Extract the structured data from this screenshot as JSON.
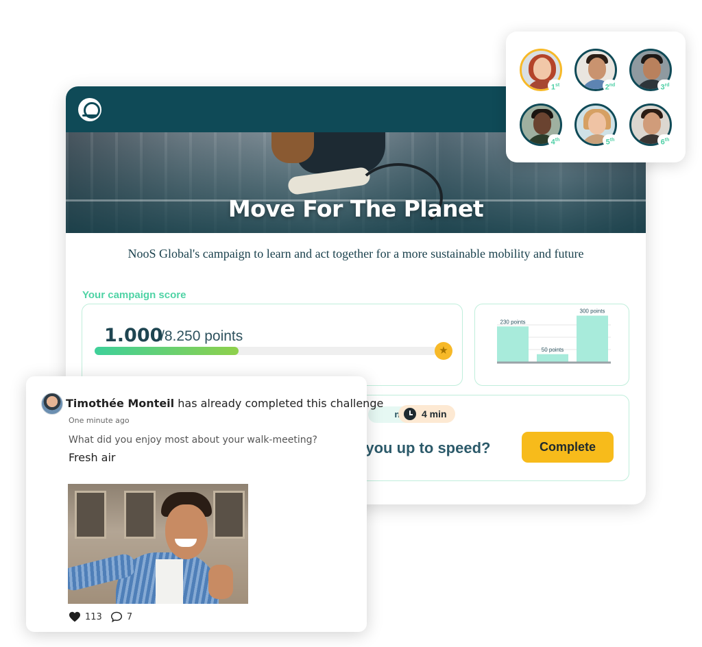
{
  "campaign": {
    "title": "Move For The Planet",
    "subtitle": "NooS Global's campaign to learn and act together for a more sustainable mobility and future"
  },
  "score": {
    "label": "Your campaign score",
    "value": "1.000",
    "total": "/8.250 points",
    "progress_fraction": 0.42
  },
  "chart_data": {
    "type": "bar",
    "categories": [
      "",
      "",
      ""
    ],
    "values": [
      230,
      50,
      300
    ],
    "data_labels": [
      "230 points",
      "50 points",
      "300 points"
    ],
    "ylim": [
      0,
      320
    ]
  },
  "challenge": {
    "points_pill": "nts",
    "time_pill": "4 min",
    "question": "e you up to speed?",
    "complete_label": "Complete"
  },
  "leaderboard": {
    "ranks": [
      {
        "n": "1",
        "suffix": "st"
      },
      {
        "n": "2",
        "suffix": "nd"
      },
      {
        "n": "3",
        "suffix": "rd"
      },
      {
        "n": "4",
        "suffix": "th"
      },
      {
        "n": "5",
        "suffix": "th"
      },
      {
        "n": "6",
        "suffix": "th"
      }
    ]
  },
  "activity": {
    "user_name": "Timothée Monteil",
    "action_text": " has already completed this challenge",
    "time": "One minute ago",
    "question": "What did you enjoy most about your walk-meeting?",
    "answer": "Fresh air",
    "likes": "113",
    "comments": "7"
  },
  "colors": {
    "brand_dark": "#0f4a57",
    "accent_green": "#4fd3a5",
    "accent_yellow": "#f7bb1b",
    "bar_fill": "#a8ebdb"
  }
}
